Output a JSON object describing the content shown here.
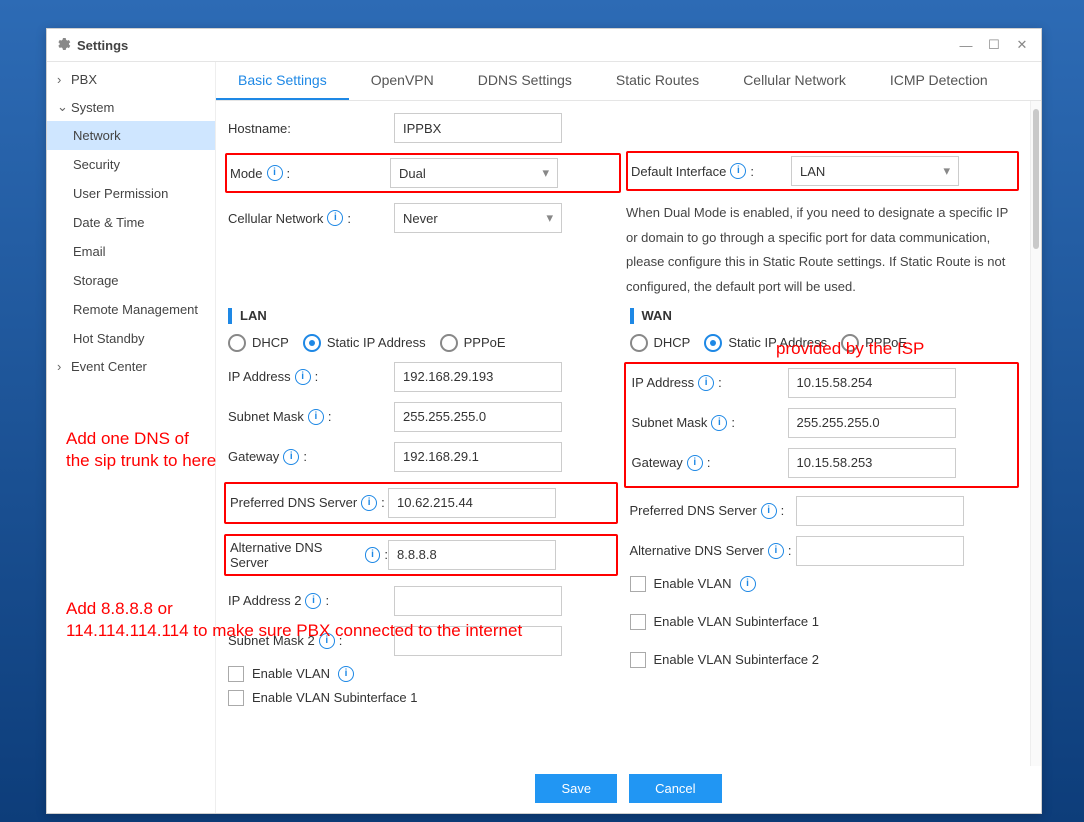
{
  "window": {
    "title": "Settings"
  },
  "sidebar": {
    "sections": [
      {
        "label": "PBX",
        "chevron": "›"
      },
      {
        "label": "System",
        "chevron": "⌄"
      },
      {
        "label": "Event Center",
        "chevron": "›"
      }
    ],
    "system_items": [
      {
        "label": "Network",
        "selected": true
      },
      {
        "label": "Security"
      },
      {
        "label": "User Permission"
      },
      {
        "label": "Date & Time"
      },
      {
        "label": "Email"
      },
      {
        "label": "Storage"
      },
      {
        "label": "Remote Management"
      },
      {
        "label": "Hot Standby"
      }
    ]
  },
  "tabs": [
    {
      "label": "Basic Settings",
      "active": true
    },
    {
      "label": "OpenVPN"
    },
    {
      "label": "DDNS Settings"
    },
    {
      "label": "Static Routes"
    },
    {
      "label": "Cellular Network"
    },
    {
      "label": "ICMP Detection"
    }
  ],
  "basic": {
    "hostname_label": "Hostname:",
    "hostname": "IPPBX",
    "mode_label": "Mode",
    "mode": "Dual",
    "default_interface_label": "Default Interface",
    "default_interface": "LAN",
    "cellular_label": "Cellular Network",
    "cellular": "Never",
    "dual_desc": "When Dual Mode is enabled, if you need to designate a specific IP or domain to go through a specific port for data communication, please configure this in Static Route settings. If Static Route is not configured, the default port will be used."
  },
  "lan": {
    "header": "LAN",
    "radio_dhcp": "DHCP",
    "radio_static": "Static IP Address",
    "radio_pppoe": "PPPoE",
    "selected": "static",
    "ip_label": "IP Address",
    "ip": "192.168.29.193",
    "mask_label": "Subnet Mask",
    "mask": "255.255.255.0",
    "gw_label": "Gateway",
    "gw": "192.168.29.1",
    "dns1_label": "Preferred DNS Server",
    "dns1": "10.62.215.44",
    "dns2_label": "Alternative DNS Server",
    "dns2": "8.8.8.8",
    "ip2_label": "IP Address 2",
    "ip2": "",
    "mask2_label": "Subnet Mask 2",
    "mask2": "",
    "vlan_label": "Enable VLAN",
    "vlan_sub1_label": "Enable VLAN Subinterface 1"
  },
  "wan": {
    "header": "WAN",
    "radio_dhcp": "DHCP",
    "radio_static": "Static IP Address",
    "radio_pppoe": "PPPoE",
    "selected": "static",
    "ip_label": "IP Address",
    "ip": "10.15.58.254",
    "mask_label": "Subnet Mask",
    "mask": "255.255.255.0",
    "gw_label": "Gateway",
    "gw": "10.15.58.253",
    "dns1_label": "Preferred DNS Server",
    "dns1": "",
    "dns2_label": "Alternative DNS Server",
    "dns2": "",
    "vlan_label": "Enable VLAN",
    "vlan_sub1_label": "Enable VLAN Subinterface 1",
    "vlan_sub2_label": "Enable VLAN Subinterface 2"
  },
  "footer": {
    "save": "Save",
    "cancel": "Cancel"
  },
  "annotations": {
    "a1": "Add one DNS of\nthe sip trunk to here",
    "a2": "Add 8.8.8.8 or\n114.114.114.114 to make sure PBX connected to the internet",
    "a3": "provided by the ISP"
  }
}
